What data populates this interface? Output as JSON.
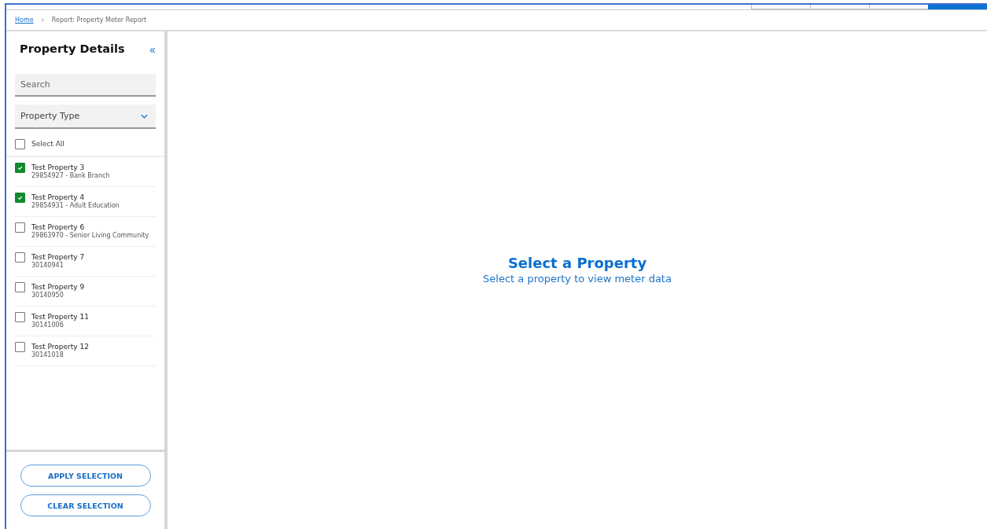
{
  "top_tabs": [
    {
      "selected": false
    },
    {
      "selected": false
    },
    {
      "selected": false
    },
    {
      "selected": true
    }
  ],
  "breadcrumb": {
    "home": "Home",
    "separator": "›",
    "current": "Report: Property Meter Report"
  },
  "sidebar": {
    "title": "Property Details",
    "collapse": "‹‹",
    "search": {
      "placeholder": "Search"
    },
    "property_type": {
      "placeholder": "Property Type"
    },
    "select_all": {
      "label": "Select All",
      "checked": false
    },
    "properties": [
      {
        "name": "Test Property 3",
        "detail": "29854927 - Bank Branch",
        "checked": true
      },
      {
        "name": "Test Property 4",
        "detail": "29854931 - Adult Education",
        "checked": true
      },
      {
        "name": "Test Property 6",
        "detail": "29863970 - Senior Living Community",
        "checked": false
      },
      {
        "name": "Test Property 7",
        "detail": "30140941",
        "checked": false
      },
      {
        "name": "Test Property 9",
        "detail": "30140950",
        "checked": false
      },
      {
        "name": "Test Property 11",
        "detail": "30141006",
        "checked": false
      },
      {
        "name": "Test Property 12",
        "detail": "30141018",
        "checked": false
      }
    ],
    "buttons": [
      "APPLY SELECTION",
      "CLEAR SELECTION"
    ]
  },
  "main": {
    "title": "Select a Property",
    "subtitle": "Select a property to view meter data"
  }
}
